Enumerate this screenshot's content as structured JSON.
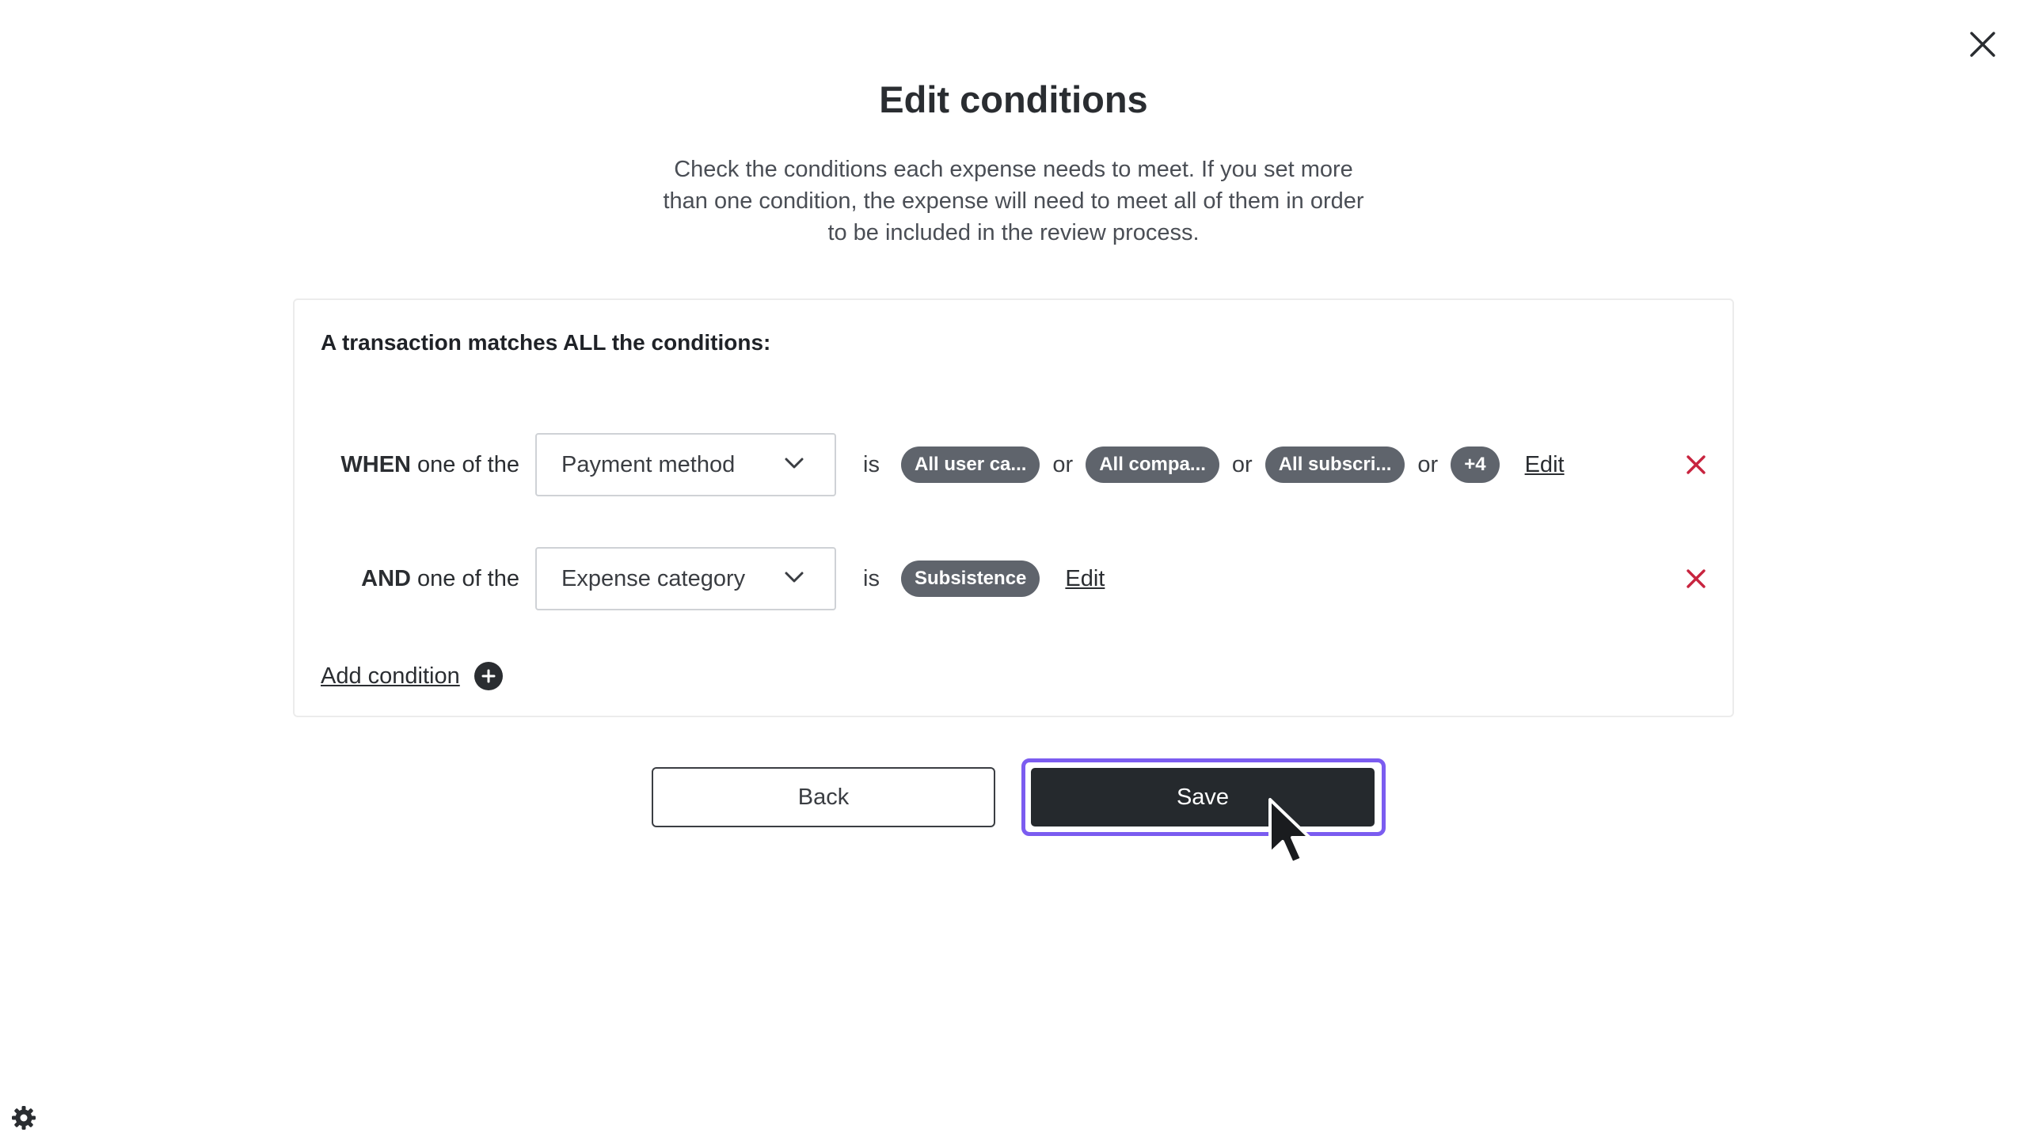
{
  "modal": {
    "title": "Edit conditions",
    "description": "Check the conditions each expense needs to meet. If you set more than one condition, the expense will need to meet all of them in order to be included in the review process."
  },
  "conditions": {
    "heading": "A transaction matches ALL the conditions:",
    "rows": [
      {
        "keyword": "WHEN",
        "lead_text": "one of the",
        "field": "Payment method",
        "operator": "is",
        "values": [
          "All user ca...",
          "All compa...",
          "All subscri...",
          "+4"
        ],
        "joiner": "or",
        "edit_label": "Edit"
      },
      {
        "keyword": "AND",
        "lead_text": "one of the",
        "field": "Expense category",
        "operator": "is",
        "values": [
          "Subsistence"
        ],
        "edit_label": "Edit"
      }
    ],
    "add_label": "Add condition"
  },
  "actions": {
    "back_label": "Back",
    "save_label": "Save"
  },
  "colors": {
    "primary": "#25292d",
    "focus_ring": "#7b5cf0",
    "remove": "#c8243f",
    "chip": "#5f646c"
  },
  "icons": [
    "close-icon",
    "chevron-down-icon",
    "remove-icon",
    "plus-circle-icon",
    "gear-icon",
    "mouse-pointer-icon"
  ]
}
